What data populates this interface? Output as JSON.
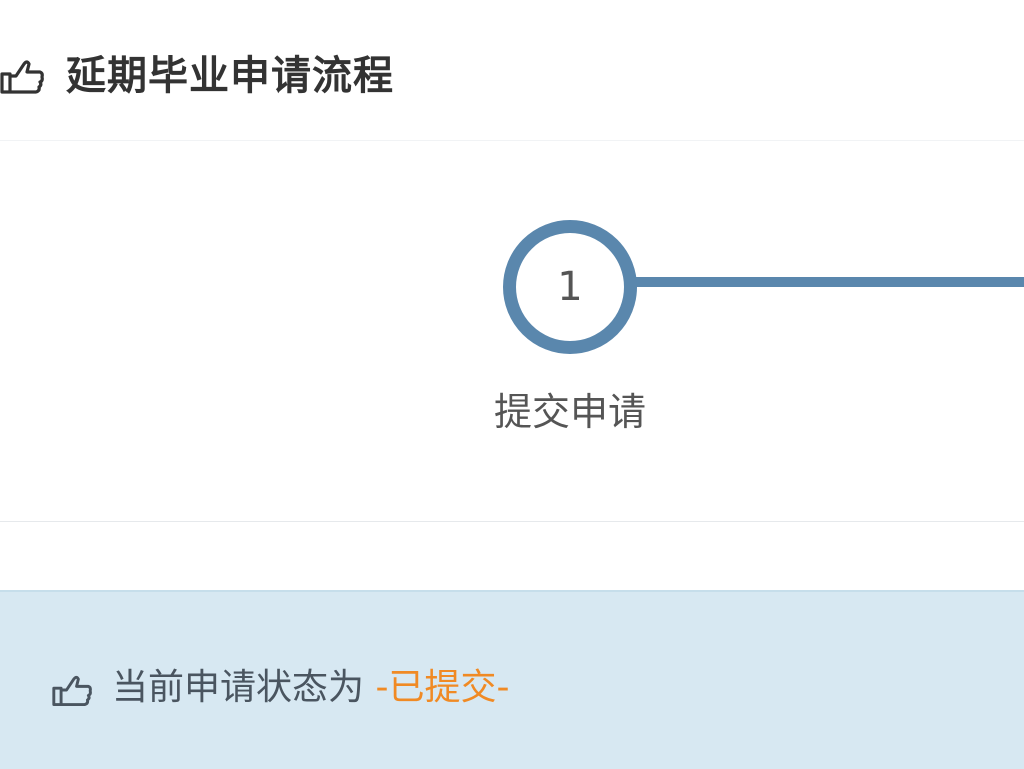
{
  "header": {
    "icon": "hand-pointing-icon",
    "title": "延期毕业申请流程"
  },
  "steps": [
    {
      "number": "1",
      "label": "提交申请"
    }
  ],
  "status": {
    "icon": "hand-pointing-icon",
    "prefix": "当前申请状态为",
    "value": "-已提交-"
  },
  "colors": {
    "step_accent": "#5a87ad",
    "status_background": "#d7e8f2",
    "status_value": "#f08a24"
  }
}
